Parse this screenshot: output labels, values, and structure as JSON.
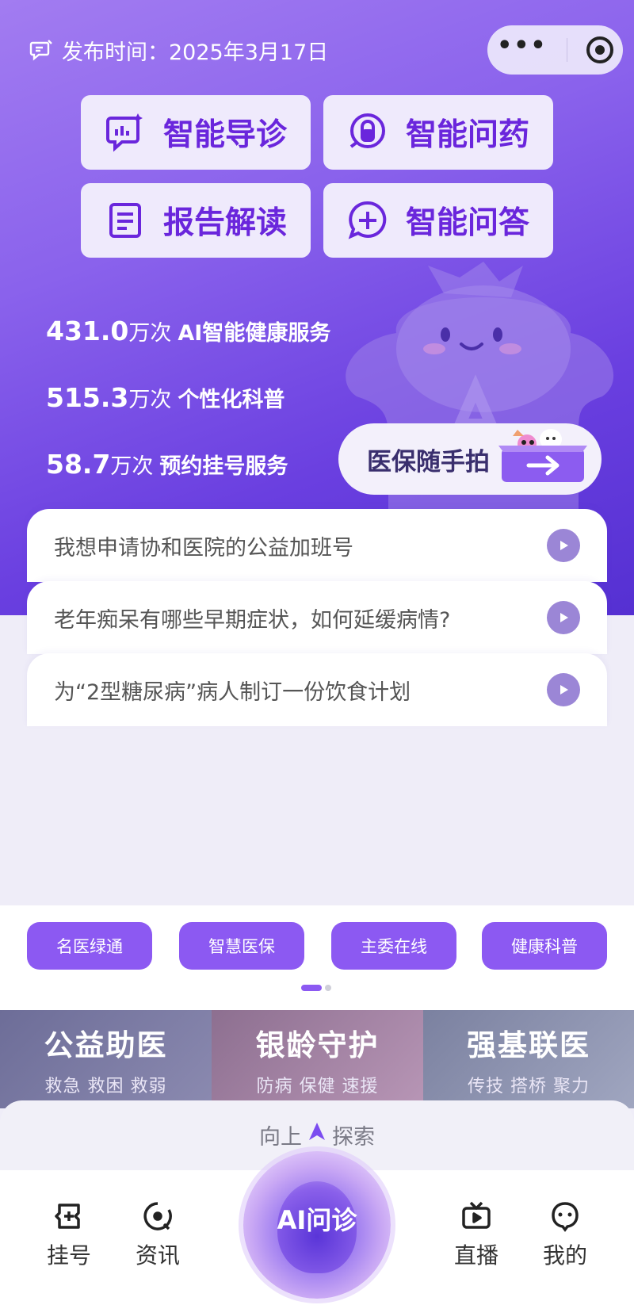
{
  "header": {
    "release_label": "发布时间：2025年3月17日"
  },
  "features": [
    {
      "label": "智能导诊",
      "icon": "ai-chart-chat-icon"
    },
    {
      "label": "智能问药",
      "icon": "pill-icon"
    },
    {
      "label": "报告解读",
      "icon": "report-doc-icon"
    },
    {
      "label": "智能问答",
      "icon": "plus-chat-icon"
    }
  ],
  "stats": [
    {
      "value": "431.0",
      "unit": "万次",
      "desc": "AI智能健康服务"
    },
    {
      "value": "515.3",
      "unit": "万次",
      "desc": "个性化科普"
    },
    {
      "value": "58.7",
      "unit": "万次",
      "desc": "预约挂号服务"
    }
  ],
  "insurance_button": {
    "label": "医保随手拍"
  },
  "questions": [
    "我想申请协和医院的公益加班号",
    "老年痴呆有哪些早期症状，如何延缓病情?",
    "为“2型糖尿病”病人制订一份饮食计划"
  ],
  "quick_links": [
    "名医绿通",
    "智慧医保",
    "主委在线",
    "健康科普"
  ],
  "banners": [
    {
      "title": "公益助医",
      "subtitle": "救急 救困 救弱",
      "color": "#7f7ea5"
    },
    {
      "title": "银龄守护",
      "subtitle": "防病 保健 速援",
      "color": "#a88aa6"
    },
    {
      "title": "强基联医",
      "subtitle": "传技 搭桥 聚力",
      "color": "#8c92ad"
    }
  ],
  "explore": {
    "left": "向上",
    "right": "探索"
  },
  "tabbar": {
    "register": "挂号",
    "news": "资讯",
    "ai": "AI问诊",
    "live": "直播",
    "mine": "我的"
  },
  "colors": {
    "accent": "#8c59f2",
    "feature_text": "#6a26dc"
  }
}
